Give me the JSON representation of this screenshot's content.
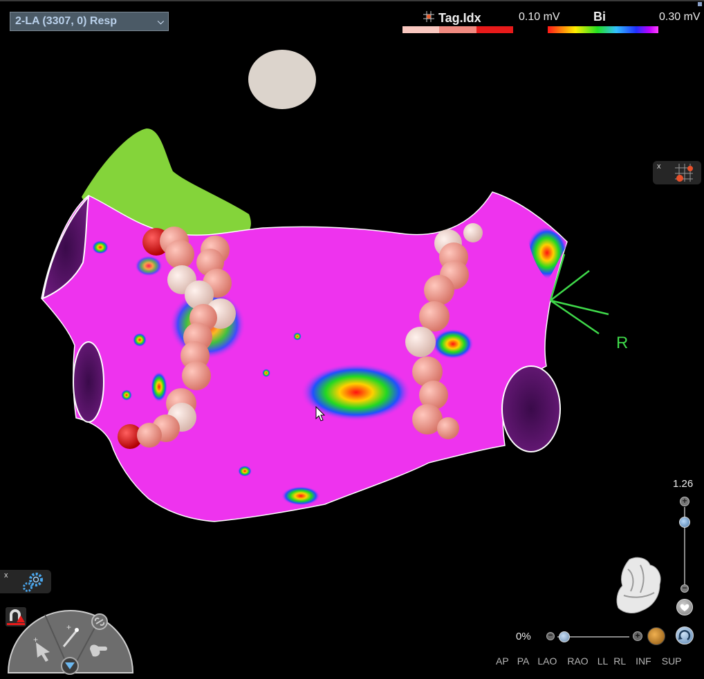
{
  "map_selector": {
    "value": "2-LA (3307, 0) Resp"
  },
  "tag_index": {
    "title": "Tag.Idx",
    "colors": [
      "#f9c8c0",
      "#f08a80",
      "#e81a1a"
    ]
  },
  "voltage": {
    "min_label": "0.10 mV",
    "title": "Bi",
    "max_label": "0.30 mV"
  },
  "orientation": {
    "label": "R"
  },
  "zoom": {
    "value": "1.26",
    "level_fraction": 0.8
  },
  "transparency": {
    "value": "0%",
    "level_fraction": 0.1
  },
  "views": [
    "AP",
    "PA",
    "LAO",
    "RAO",
    "LL",
    "RL",
    "INF",
    "SUP"
  ],
  "panels": {
    "close_label": "x"
  },
  "colors": {
    "tissue": "#ee33ee",
    "appendage": "#84d43a",
    "tag_light": "#f3d5ce",
    "tag_salmon": "#ee9a8e",
    "tag_red": "#e21010"
  }
}
